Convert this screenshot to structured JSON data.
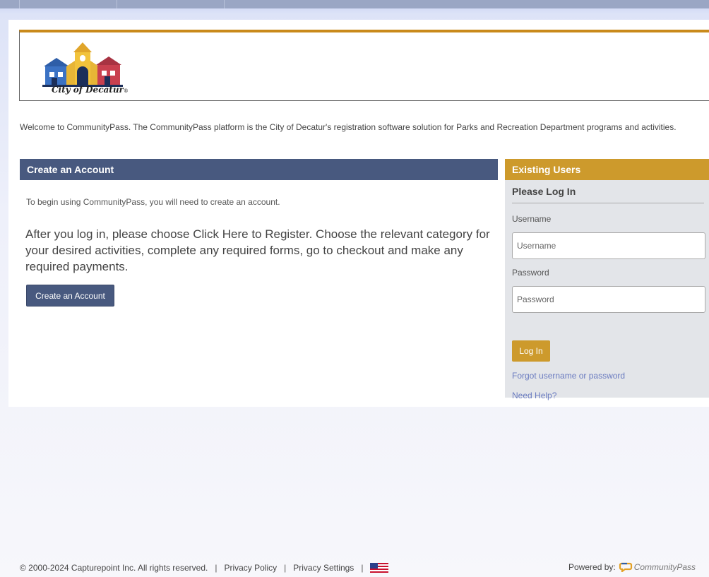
{
  "branding": {
    "logo_label": "City of Decatur",
    "logo_mark": "®"
  },
  "intro": "Welcome to CommunityPass.  The CommunityPass platform is the City of Decatur's registration software solution for Parks and Recreation Department programs and activities.",
  "create_account": {
    "heading": "Create an Account",
    "begin_text": "To begin using CommunityPass, you will need to create an account.",
    "instructions": "After you log in, please choose Click Here to Register. Choose the relevant category for your desired activities, complete any required forms, go to checkout and make any required payments.",
    "button_label": "Create an Account"
  },
  "login": {
    "heading": "Existing Users",
    "subheading": "Please Log In",
    "username_label": "Username",
    "username_placeholder": "Username",
    "password_label": "Password",
    "password_placeholder": "Password",
    "button_label": "Log In",
    "forgot_link": "Forgot username or password",
    "help_link": "Need Help?"
  },
  "footer": {
    "copyright": "© 2000-2024 Capturepoint Inc. All rights reserved.",
    "sep": "|",
    "privacy_policy": "Privacy Policy",
    "privacy_settings": "Privacy Settings",
    "powered_by": "Powered by:",
    "brand": "CommunityPass",
    "flag_icon": "us-flag-icon"
  },
  "colors": {
    "nav_blue": "#48597f",
    "gold": "#cd9a2c",
    "link": "#6a7bc0"
  }
}
